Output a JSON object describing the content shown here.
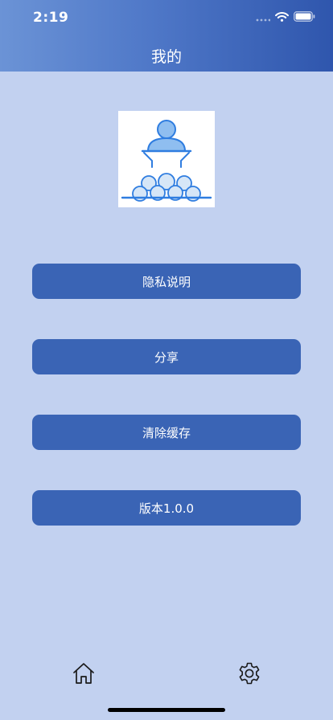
{
  "status_bar": {
    "time": "2:19",
    "icons": [
      "signal-icon",
      "wifi-icon",
      "battery-icon"
    ]
  },
  "header": {
    "title": "我的"
  },
  "menu": {
    "privacy_label": "隐私说明",
    "share_label": "分享",
    "clear_cache_label": "清除缓存",
    "version_label": "版本1.0.0"
  },
  "tab_bar": {
    "icons": [
      "home-icon",
      "gear-icon"
    ]
  },
  "colors": {
    "background": "#c2d1f0",
    "header_start": "#6b93d6",
    "header_end": "#2f56ad",
    "button": "#3a64b5",
    "avatar_accent": "#2f7de0",
    "avatar_fill": "#8fbef0"
  }
}
